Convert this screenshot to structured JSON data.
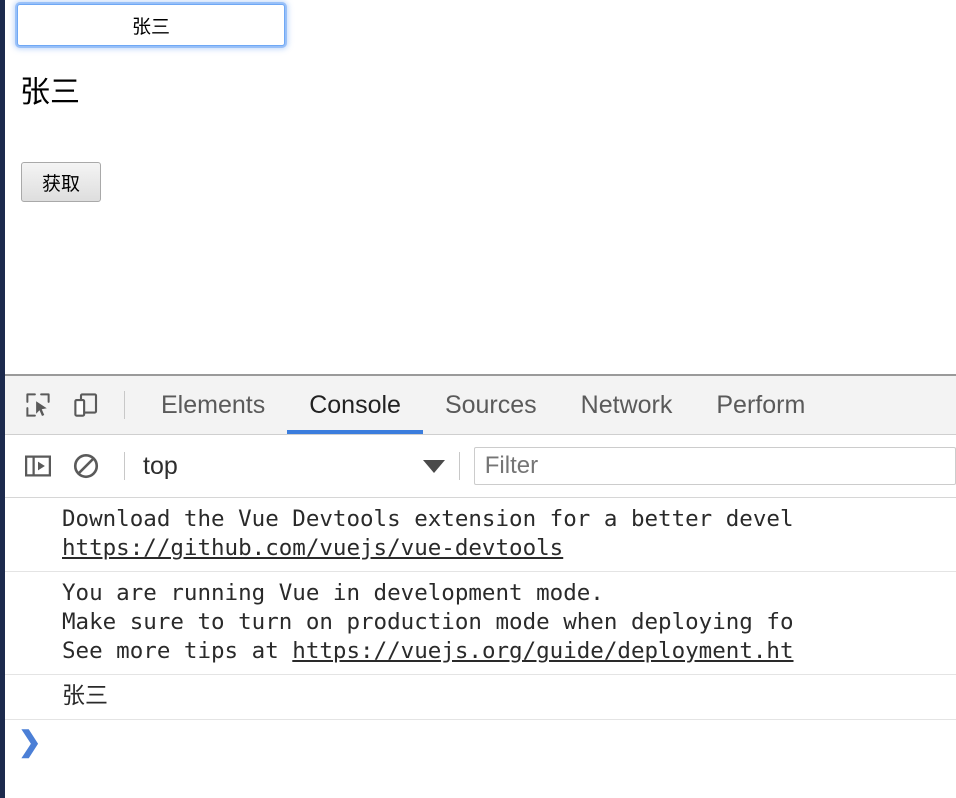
{
  "page": {
    "name_input": {
      "value": "张三",
      "placeholder": ""
    },
    "name_display": "张三",
    "fetch_button_label": "获取"
  },
  "devtools": {
    "toolbar_icons": [
      {
        "name": "inspect-element-icon",
        "label": "Inspect element"
      },
      {
        "name": "device-toolbar-icon",
        "label": "Toggle device toolbar"
      }
    ],
    "tabs": [
      {
        "label": "Elements",
        "active": false
      },
      {
        "label": "Console",
        "active": true
      },
      {
        "label": "Sources",
        "active": false
      },
      {
        "label": "Network",
        "active": false
      },
      {
        "label": "Perform",
        "active": false
      }
    ],
    "active_tab": "Console",
    "active_tab_color": "#3b7ddd",
    "filterbar": {
      "sidebar_toggle_icon": "console-sidebar-toggle-icon",
      "clear_console_icon": "clear-console-icon",
      "context_value": "top",
      "filter_placeholder": "Filter",
      "filter_value": ""
    },
    "console": {
      "messages": [
        {
          "lines": [
            {
              "text": "Download the Vue Devtools extension for a better devel",
              "link": false
            },
            {
              "text": "https://github.com/vuejs/vue-devtools",
              "link": true
            }
          ]
        },
        {
          "lines": [
            {
              "text": "You are running Vue in development mode.",
              "link": false
            },
            {
              "text": "Make sure to turn on production mode when deploying fo",
              "link": false
            },
            {
              "text": "See more tips at ",
              "link": false,
              "suffix_link": "https://vuejs.org/guide/deployment.ht"
            }
          ]
        },
        {
          "lines": [
            {
              "text": "张三",
              "link": false,
              "cjk": true
            }
          ]
        }
      ],
      "prompt_symbol": "❯",
      "prompt_color": "#4b7fd6"
    }
  }
}
